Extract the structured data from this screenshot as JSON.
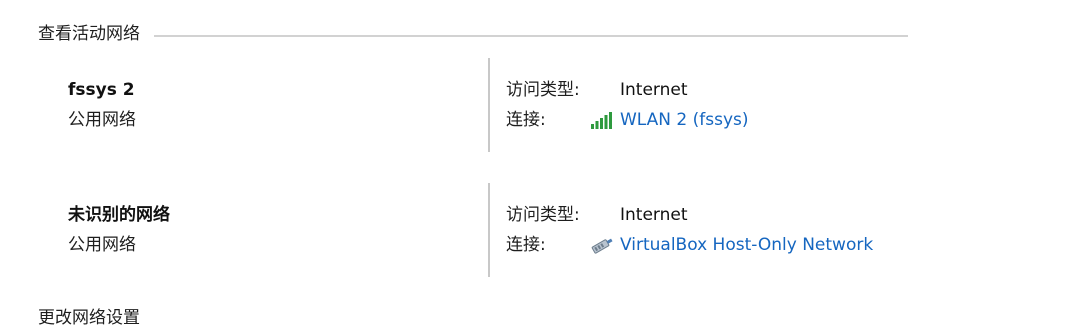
{
  "section": {
    "title": "查看活动网络"
  },
  "networks": [
    {
      "name": "fssys 2",
      "category": "公用网络",
      "access_type_label": "访问类型:",
      "access_type_value": "Internet",
      "connection_label": "连接:",
      "connection_name": "WLAN 2 (fssys)",
      "connection_icon": "wifi-signal-icon"
    },
    {
      "name": "未识别的网络",
      "category": "公用网络",
      "access_type_label": "访问类型:",
      "access_type_value": "Internet",
      "connection_label": "连接:",
      "connection_name": "VirtualBox Host-Only Network",
      "connection_icon": "ethernet-cable-icon"
    }
  ],
  "footer": {
    "change_settings": "更改网络设置"
  },
  "colors": {
    "link": "#1566c0",
    "signal_green": "#2e9a3e",
    "divider": "#c8c8c8"
  }
}
